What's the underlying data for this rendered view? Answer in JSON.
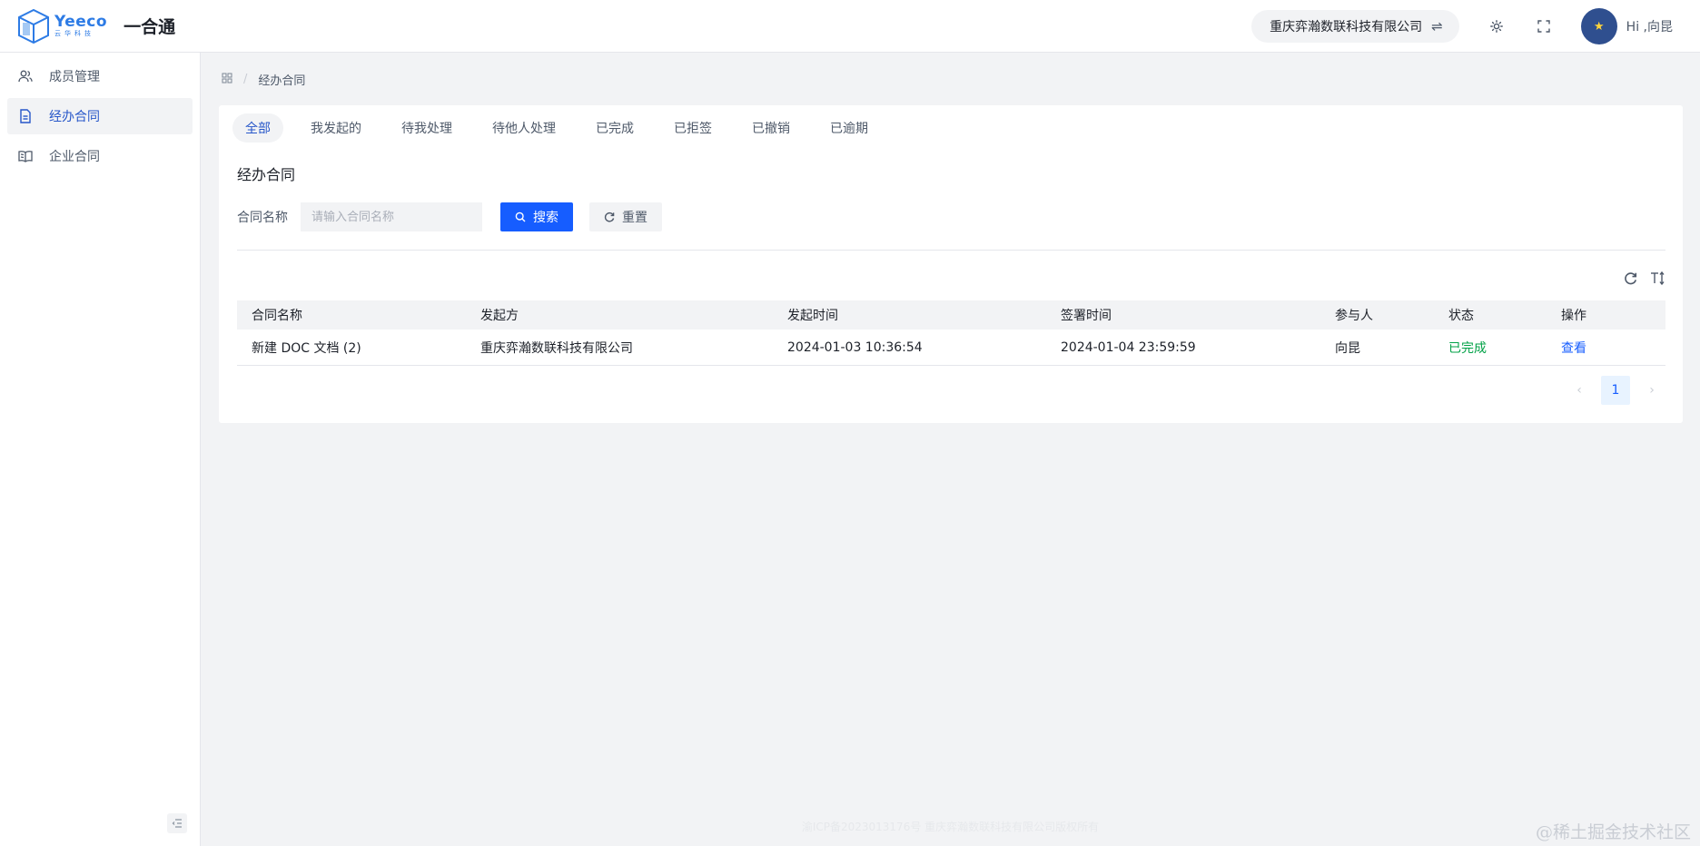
{
  "header": {
    "logo_brand": "Yeeco",
    "logo_sub": "云华科技",
    "app_name": "一合通",
    "company_name": "重庆弈瀚数联科技有限公司",
    "swap_icon": "⇌",
    "greeting": "Hi ,向昆"
  },
  "sidebar": {
    "items": [
      {
        "label": "成员管理",
        "icon": "users-icon",
        "active": false
      },
      {
        "label": "经办合同",
        "icon": "document-icon",
        "active": true
      },
      {
        "label": "企业合同",
        "icon": "book-icon",
        "active": false
      }
    ]
  },
  "breadcrumb": {
    "current": "经办合同",
    "separator": "/"
  },
  "tabs": [
    {
      "label": "全部",
      "active": true
    },
    {
      "label": "我发起的",
      "active": false
    },
    {
      "label": "待我处理",
      "active": false
    },
    {
      "label": "待他人处理",
      "active": false
    },
    {
      "label": "已完成",
      "active": false
    },
    {
      "label": "已拒签",
      "active": false
    },
    {
      "label": "已撤销",
      "active": false
    },
    {
      "label": "已逾期",
      "active": false
    }
  ],
  "main": {
    "title": "经办合同",
    "filter_label": "合同名称",
    "filter_placeholder": "请输入合同名称",
    "filter_value": "",
    "search_label": "搜索",
    "reset_label": "重置"
  },
  "table": {
    "columns": [
      "合同名称",
      "发起方",
      "发起时间",
      "签署时间",
      "参与人",
      "状态",
      "操作"
    ],
    "rows": [
      {
        "name": "新建 DOC 文档 (2)",
        "initiator": "重庆弈瀚数联科技有限公司",
        "start_time": "2024-01-03 10:36:54",
        "sign_time": "2024-01-04 23:59:59",
        "participant": "向昆",
        "status": "已完成",
        "action": "查看"
      }
    ]
  },
  "pagination": {
    "prev": "‹",
    "current": "1",
    "next": "›"
  },
  "footer": {
    "text": "渝ICP备2023013176号 重庆弈瀚数联科技有限公司版权所有"
  },
  "watermark": "@稀土掘金技术社区",
  "colors": {
    "primary": "#165dff",
    "active_text": "#2656c9",
    "success": "#00a146",
    "background": "#f2f3f5"
  }
}
